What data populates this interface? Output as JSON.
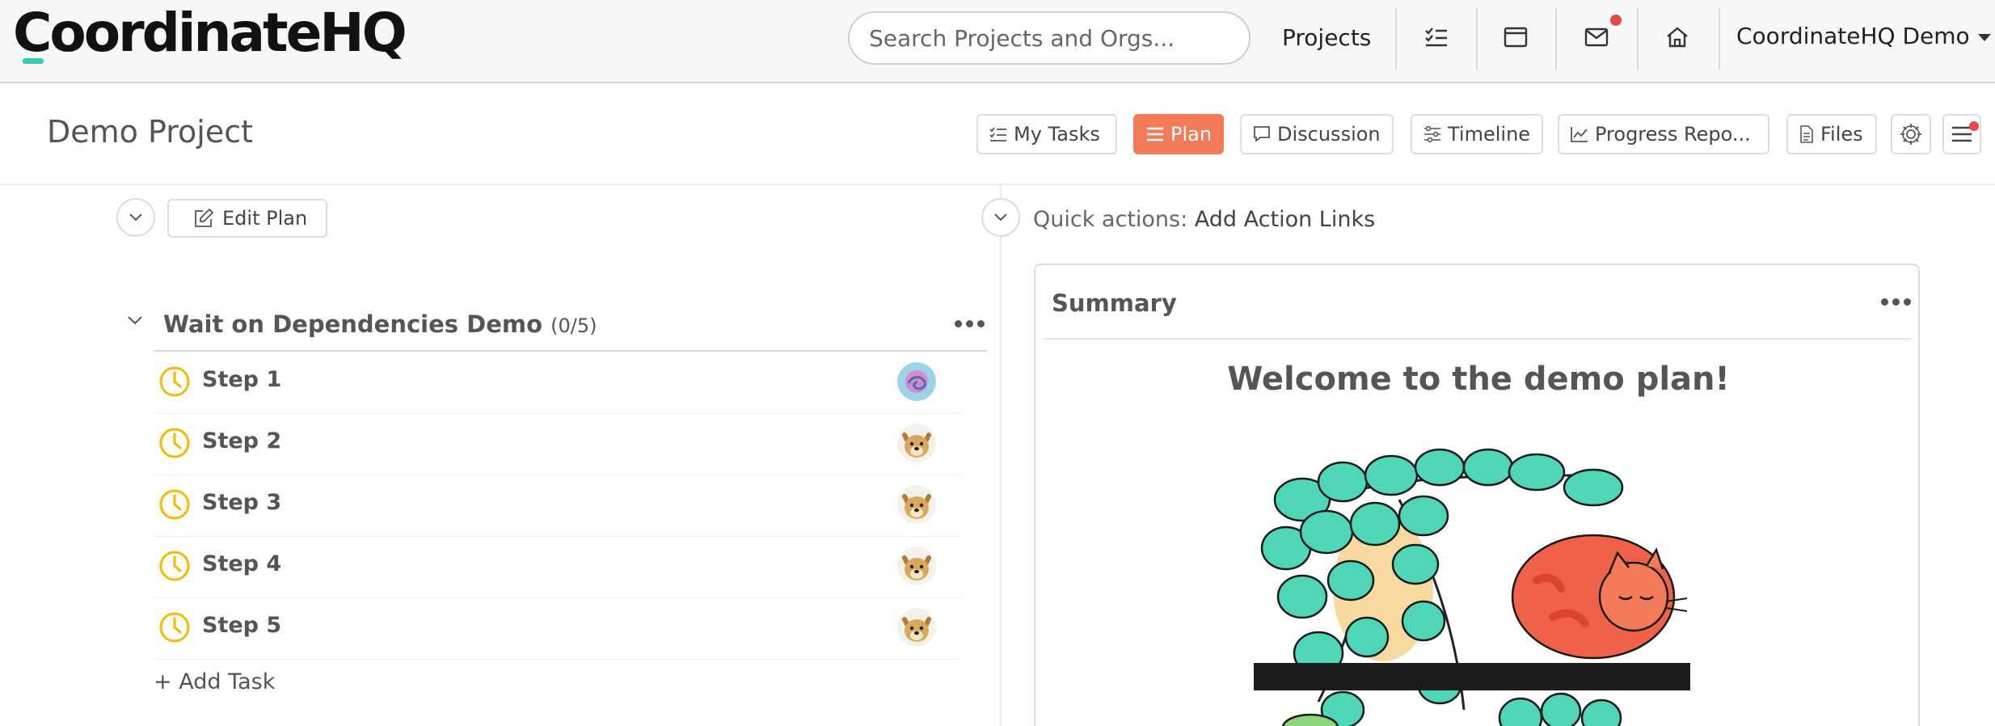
{
  "nav": {
    "logo": "CoordinateHQ",
    "search_placeholder": "Search Projects and Orgs...",
    "projects_label": "Projects",
    "account_label": "CoordinateHQ Demo",
    "icons": [
      "tasks-icon",
      "calendar-icon",
      "mail-icon",
      "home-icon"
    ],
    "badge_color": "#e84a4a"
  },
  "project": {
    "title": "Demo Project",
    "tabs": [
      {
        "label": "My Tasks",
        "icon": "checklist-icon"
      },
      {
        "label": "Plan",
        "icon": "list-icon",
        "active": true
      },
      {
        "label": "Discussion",
        "icon": "speech-bubble-icon"
      },
      {
        "label": "Timeline",
        "icon": "sliders-icon"
      },
      {
        "label": "Progress Repo...",
        "icon": "line-chart-icon"
      },
      {
        "label": "Files",
        "icon": "file-icon"
      }
    ],
    "accent_color": "#f47b5a"
  },
  "plan": {
    "edit_label": "Edit Plan",
    "group": {
      "title": "Wait on Dependencies Demo",
      "count": "(0/5)",
      "tasks": [
        {
          "label": "Step 1",
          "avatar": "swirl-avatar"
        },
        {
          "label": "Step 2",
          "avatar": "dog-avatar"
        },
        {
          "label": "Step 3",
          "avatar": "dog-avatar"
        },
        {
          "label": "Step 4",
          "avatar": "dog-avatar"
        },
        {
          "label": "Step 5",
          "avatar": "dog-avatar"
        }
      ]
    },
    "add_task_label": "+ Add Task",
    "pending_color": "#f5b800"
  },
  "quick_actions": {
    "prefix": "Quick actions:",
    "link": "Add Action Links"
  },
  "summary": {
    "title": "Summary",
    "heading": "Welcome to the demo plan!",
    "illustration": "plant-and-cat-illustration"
  }
}
